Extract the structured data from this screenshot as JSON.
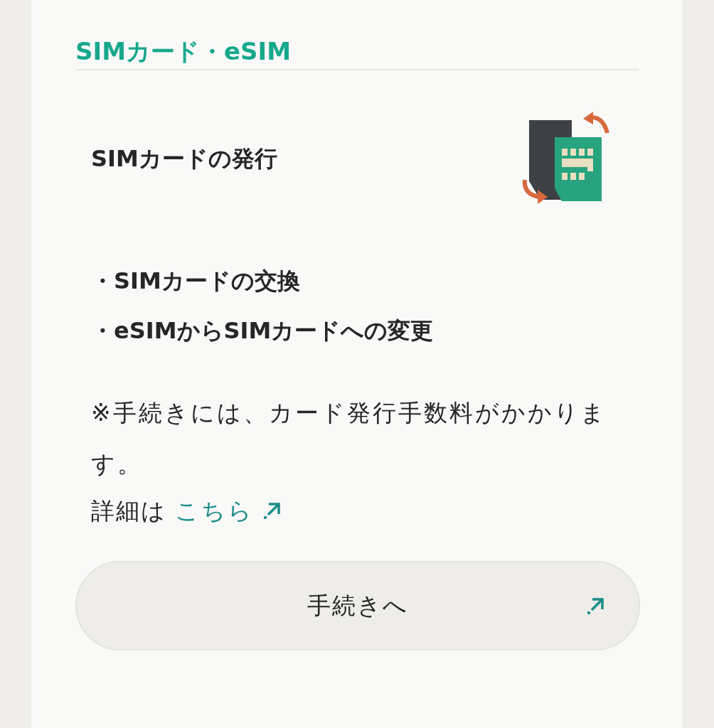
{
  "section": {
    "title": "SIMカード・eSIM"
  },
  "item": {
    "heading": "SIMカードの発行",
    "bullets": [
      "・SIMカードの交換",
      "・eSIMからSIMカードへの変更"
    ],
    "note": "※手続きには、カード発行手数料がかかります。",
    "detail": {
      "text": "詳細は",
      "link": "こちら"
    },
    "button": {
      "label": "手続きへ"
    }
  }
}
